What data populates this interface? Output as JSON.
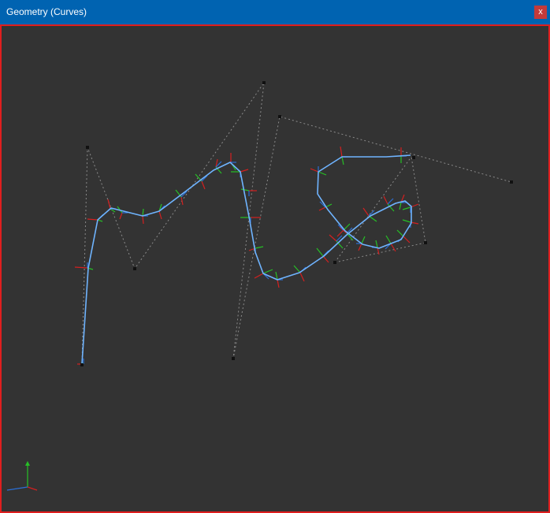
{
  "window": {
    "title": "Geometry (Curves)",
    "close_label": "x"
  },
  "viewport": {
    "background": "#333333",
    "border_color": "#e01e1e"
  },
  "colors": {
    "curve": "#6fb4ff",
    "control_polygon": "#8a8a8a",
    "control_point": "#111111",
    "tangent": "#2b6fd6",
    "normal": "#d42020",
    "binormal": "#26c026",
    "axis_x": "#d42020",
    "axis_y": "#26c026",
    "axis_z": "#2b6fd6"
  }
}
